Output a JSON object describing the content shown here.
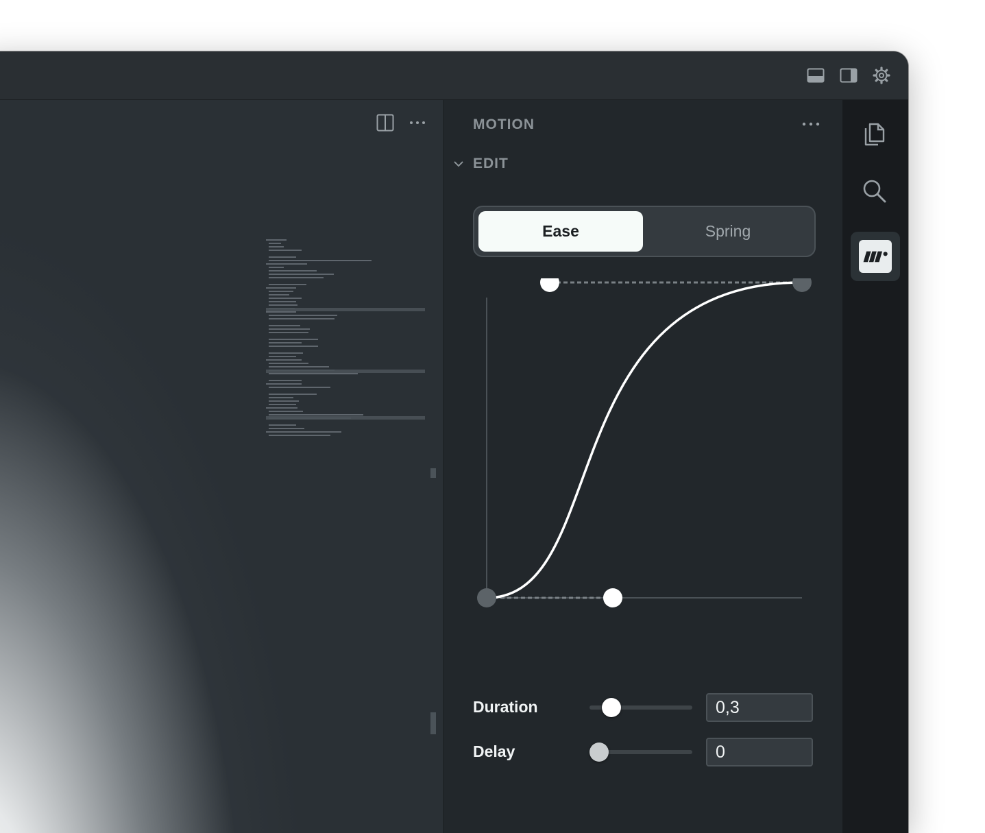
{
  "editor": {
    "minimap_lines": 58
  },
  "panel": {
    "title": "MOTION",
    "section": "EDIT",
    "tabs": {
      "ease": "Ease",
      "spring": "Spring",
      "selected": "Ease"
    },
    "duration": {
      "label": "Duration",
      "value": "0,3",
      "slider_fraction": 0.21
    },
    "delay": {
      "label": "Delay",
      "value": "0",
      "slider_fraction": 0.09
    }
  },
  "colors": {
    "accent": "#f6fbf9",
    "panel_bg": "#22272b",
    "activity_bg": "#181b1e"
  },
  "icons": {
    "titlebar": [
      "panel-bottom-icon",
      "panel-right-icon",
      "gear-icon"
    ],
    "editor": [
      "split-editor-icon",
      "more-icon"
    ],
    "activity": [
      "files-icon",
      "search-icon",
      "motion-extension-icon"
    ]
  }
}
